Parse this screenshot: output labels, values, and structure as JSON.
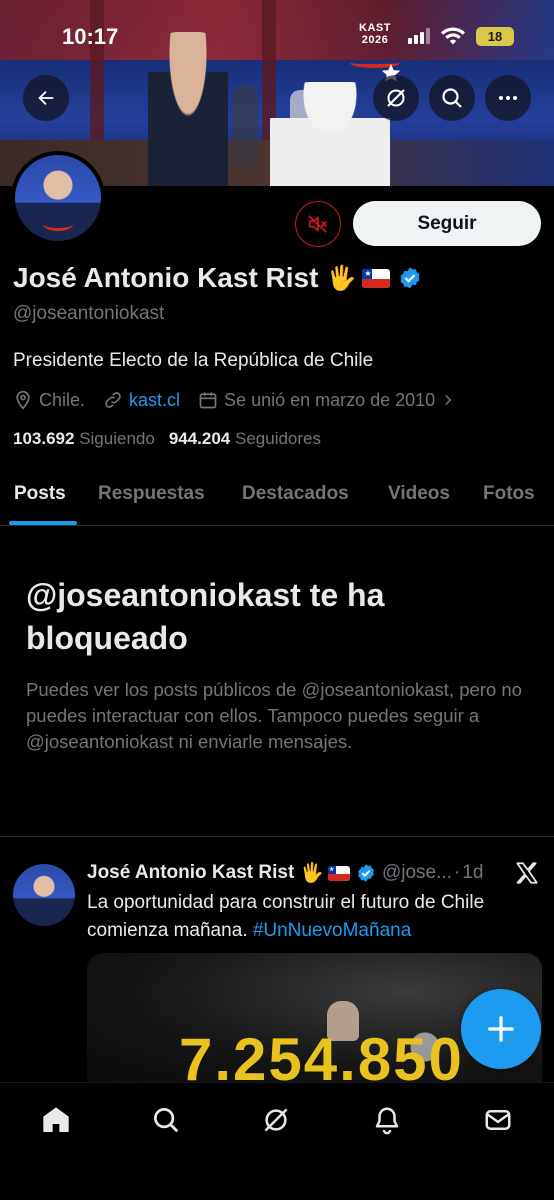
{
  "status_bar": {
    "time": "10:17",
    "battery": "18"
  },
  "banner": {
    "logo_line1": "KAST",
    "logo_line2": "2026"
  },
  "top_actions": {
    "back_icon": "arrow-left-icon",
    "grok_icon": "grok-icon",
    "search_icon": "search-icon",
    "more_icon": "more-horizontal-icon"
  },
  "profile": {
    "name": "José Antonio Kast Rist",
    "emoji": "🖐",
    "handle": "@joseantoniokast",
    "bio": "Presidente Electo de la República de Chile",
    "location": "Chile.",
    "website": "kast.cl",
    "joined": "Se unió en marzo de 2010",
    "following_count": "103.692",
    "following_label": "Siguiendo",
    "followers_count": "944.204",
    "followers_label": "Seguidores",
    "follow_button": "Seguir"
  },
  "tabs": [
    "Posts",
    "Respuestas",
    "Destacados",
    "Videos",
    "Fotos"
  ],
  "blocked": {
    "title": "@joseantoniokast te ha bloqueado",
    "text": "Puedes ver los posts públicos de @joseantoniokast, pero no puedes interactuar con ellos. Tampoco puedes seguir a @joseantoniokast ni enviarle mensajes."
  },
  "post": {
    "name": "José Antonio Kast Rist",
    "emoji": "🖐",
    "handle": "@jose...",
    "dot": "·",
    "time": "1d",
    "text_main": "La oportunidad para construir el futuro de Chile comienza mañana. ",
    "hashtag": "#UnNuevoMañana",
    "media_number": "7.254.850"
  },
  "colors": {
    "accent": "#1d9bf0",
    "mute_border": "#c8181f",
    "background": "#000000"
  },
  "bottom_nav": [
    "home-icon",
    "search-icon",
    "grok-icon",
    "notifications-icon",
    "messages-icon"
  ]
}
